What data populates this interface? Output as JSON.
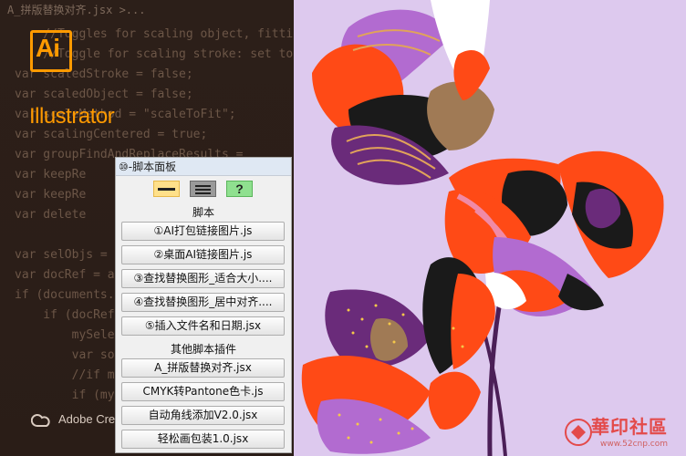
{
  "editor": {
    "file_tab": "A_拼版替换对齐.jsx >...",
    "code_lines": [
      "    //Toggles for scaling object, fitting...",
      "    //Toggle for scaling stroke: set to",
      "var scaledStroke = false;",
      "var scaledObject = false;",
      "var scaleMethod = \"scaleToFit\";",
      "var scalingCentered = true;",
      "var groupFindAndReplaceResults = ",
      "var keepRe",
      "var keepRe",
      "var delete",
      "",
      "var selObjs =",
      "var docRef = a",
      "if (documents.",
      "    if (docRef",
      "        mySele",
      "        var so",
      "        //if m",
      "        if (my"
    ]
  },
  "splash": {
    "logo_text": "Ai",
    "product_name": "Illustrator",
    "footer_text": "Adobe Cre"
  },
  "panel": {
    "title": "⑩-脚本面板",
    "toolbar": [
      "minimize",
      "list",
      "?"
    ],
    "section1": "脚本",
    "scripts": [
      "①AI打包链接图片.js",
      "②桌面AI链接图片.js",
      "③查找替换图形_适合大小....",
      "④查找替换图形_居中对齐....",
      "⑤插入文件名和日期.jsx"
    ],
    "section2": "其他脚本插件",
    "plugins": [
      "A_拼版替换对齐.jsx",
      "CMYK转Pantone色卡.js",
      "自动角线添加V2.0.jsx",
      "轻松画包装1.0.jsx"
    ]
  },
  "watermark": {
    "title": "華印社區",
    "url": "www.52cnp.com"
  },
  "colors": {
    "accent": "#ff9a00",
    "art_background": "#ddc9ee"
  }
}
